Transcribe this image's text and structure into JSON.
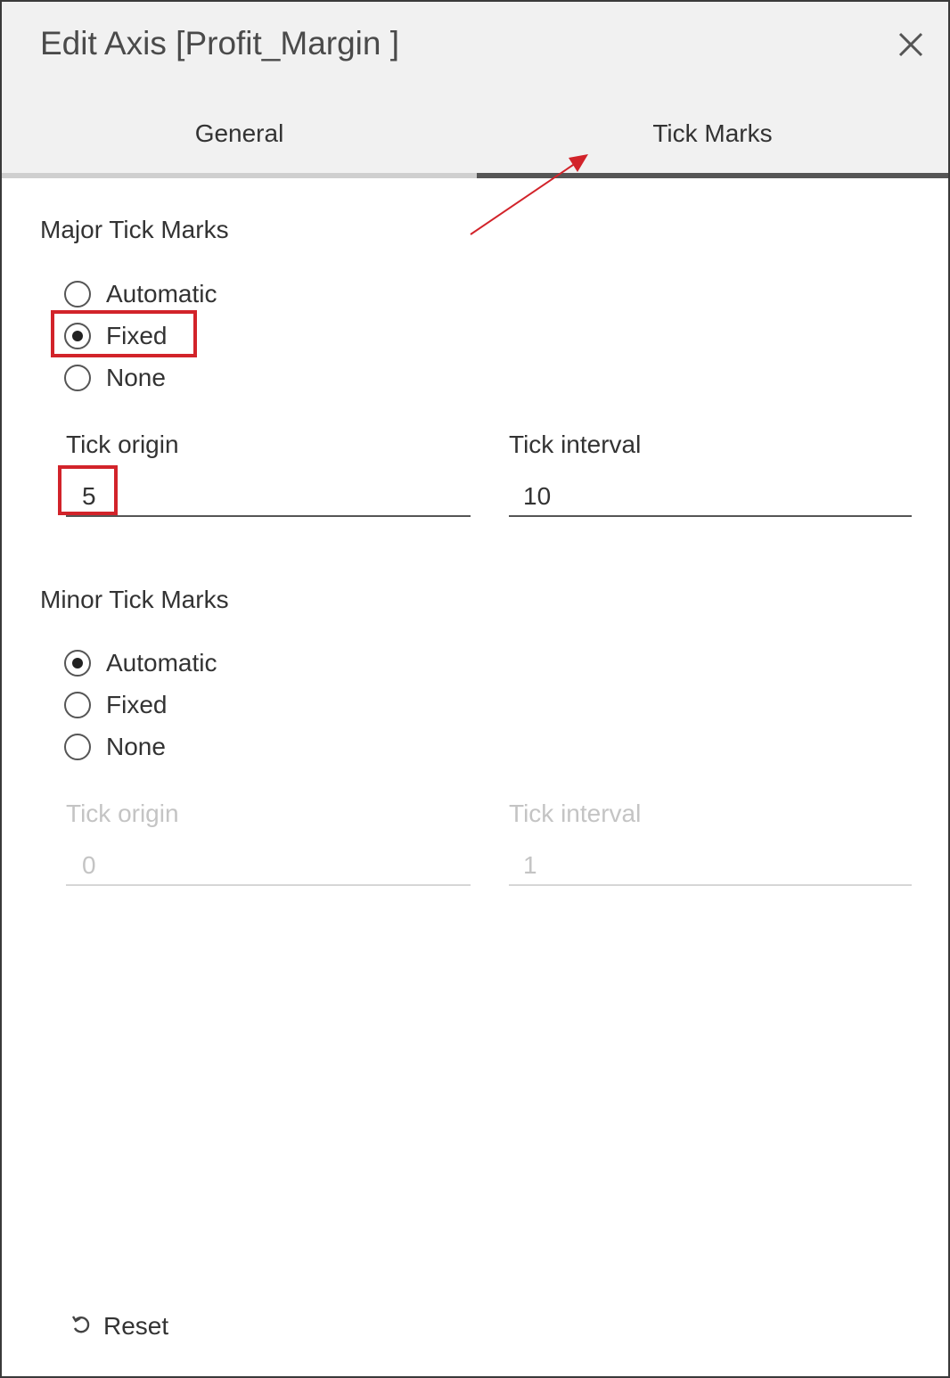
{
  "dialog": {
    "title": "Edit Axis [Profit_Margin ]",
    "close_icon": "close-icon",
    "tabs": [
      {
        "label": "General",
        "active": false
      },
      {
        "label": "Tick Marks",
        "active": true
      }
    ]
  },
  "major": {
    "title": "Major Tick Marks",
    "options": [
      {
        "label": "Automatic",
        "checked": false
      },
      {
        "label": "Fixed",
        "checked": true
      },
      {
        "label": "None",
        "checked": false
      }
    ],
    "tick_origin": {
      "label": "Tick origin",
      "value": "5"
    },
    "tick_interval": {
      "label": "Tick interval",
      "value": "10"
    }
  },
  "minor": {
    "title": "Minor Tick Marks",
    "options": [
      {
        "label": "Automatic",
        "checked": true
      },
      {
        "label": "Fixed",
        "checked": false
      },
      {
        "label": "None",
        "checked": false
      }
    ],
    "tick_origin": {
      "label": "Tick origin",
      "value": "0",
      "disabled": true
    },
    "tick_interval": {
      "label": "Tick interval",
      "value": "1",
      "disabled": true
    }
  },
  "footer": {
    "reset_label": "Reset",
    "reset_icon": "reset-icon"
  },
  "annotation": {
    "color": "#d2232a"
  }
}
